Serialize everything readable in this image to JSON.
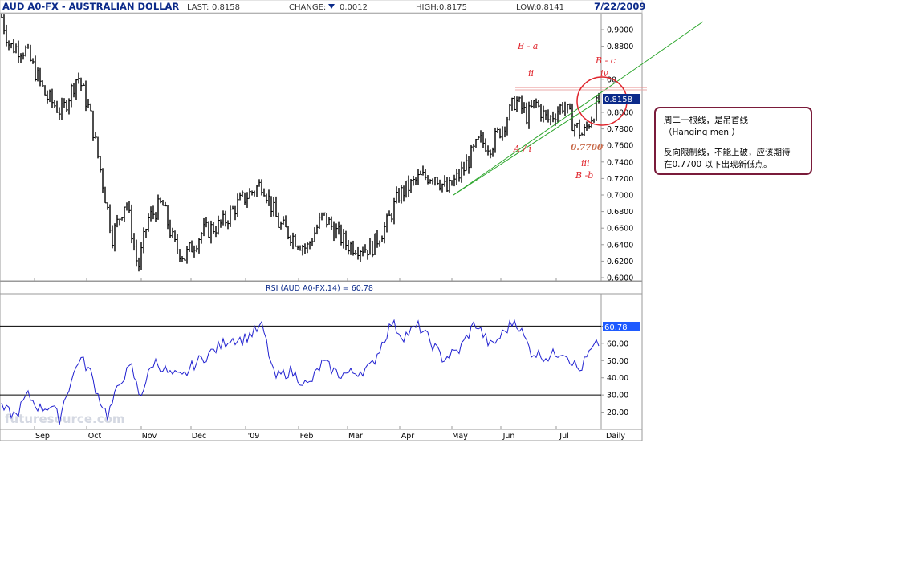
{
  "header": {
    "title": "AUD A0-FX - AUSTRALIAN DOLLAR",
    "last_label": "LAST:",
    "last_value": "0.8158",
    "change_label": "CHANGE:",
    "change_value": "0.0012",
    "high_label": "HIGH:",
    "high_value": "0.8175",
    "low_label": "LOW:",
    "low_value": "0.8141",
    "date": "7/22/2009"
  },
  "chart_data": [
    {
      "type": "bar",
      "title": "AUD A0-FX - AUSTRALIAN DOLLAR",
      "period": "Daily",
      "ylim": [
        0.6,
        0.92
      ],
      "y_ticks": [
        "0.9000",
        "0.8800",
        "00",
        "0.8000",
        "0.7800",
        "0.7600",
        "0.7400",
        "0.7200",
        "0.7000",
        "0.6800",
        "0.6600",
        "0.6400",
        "0.6200",
        "0.6000"
      ],
      "y_tick_values": [
        0.9,
        0.88,
        0.84,
        0.8,
        0.78,
        0.76,
        0.74,
        0.72,
        0.7,
        0.68,
        0.66,
        0.64,
        0.62,
        0.6
      ],
      "last_price_label": "0.8158",
      "last_price": 0.8158,
      "x_ticks": [
        "Sep",
        "Oct",
        "Nov",
        "Dec",
        "'09",
        "Feb",
        "Mar",
        "Apr",
        "May",
        "Jun",
        "Jul",
        "Daily"
      ],
      "close_keypoints": [
        {
          "t": 0,
          "v": 0.915
        },
        {
          "t": 10,
          "v": 0.88
        },
        {
          "t": 30,
          "v": 0.875
        },
        {
          "t": 55,
          "v": 0.82
        },
        {
          "t": 75,
          "v": 0.8
        },
        {
          "t": 95,
          "v": 0.845
        },
        {
          "t": 110,
          "v": 0.8
        },
        {
          "t": 125,
          "v": 0.72
        },
        {
          "t": 138,
          "v": 0.65
        },
        {
          "t": 155,
          "v": 0.695
        },
        {
          "t": 170,
          "v": 0.61
        },
        {
          "t": 182,
          "v": 0.67
        },
        {
          "t": 200,
          "v": 0.69
        },
        {
          "t": 215,
          "v": 0.64
        },
        {
          "t": 228,
          "v": 0.625
        },
        {
          "t": 250,
          "v": 0.655
        },
        {
          "t": 275,
          "v": 0.665
        },
        {
          "t": 295,
          "v": 0.69
        },
        {
          "t": 325,
          "v": 0.715
        },
        {
          "t": 345,
          "v": 0.665
        },
        {
          "t": 380,
          "v": 0.635
        },
        {
          "t": 400,
          "v": 0.675
        },
        {
          "t": 430,
          "v": 0.64
        },
        {
          "t": 460,
          "v": 0.635
        },
        {
          "t": 480,
          "v": 0.665
        },
        {
          "t": 495,
          "v": 0.7
        },
        {
          "t": 520,
          "v": 0.72
        },
        {
          "t": 540,
          "v": 0.725
        },
        {
          "t": 555,
          "v": 0.705
        },
        {
          "t": 575,
          "v": 0.73
        },
        {
          "t": 595,
          "v": 0.765
        },
        {
          "t": 610,
          "v": 0.76
        },
        {
          "t": 628,
          "v": 0.79
        },
        {
          "t": 640,
          "v": 0.815
        },
        {
          "t": 655,
          "v": 0.795
        },
        {
          "t": 665,
          "v": 0.812
        },
        {
          "t": 680,
          "v": 0.79
        },
        {
          "t": 700,
          "v": 0.81
        },
        {
          "t": 710,
          "v": 0.79
        },
        {
          "t": 724,
          "v": 0.772
        },
        {
          "t": 735,
          "v": 0.795
        },
        {
          "t": 745,
          "v": 0.8158
        }
      ],
      "annotations": [
        {
          "text": "B - a",
          "x": 650,
          "y": 0.882
        },
        {
          "text": "B - c",
          "x": 747,
          "y": 0.856
        },
        {
          "text": "ii",
          "x": 662,
          "y": 0.846
        },
        {
          "text": "iv",
          "x": 752,
          "y": 0.846
        },
        {
          "text": "A / i",
          "x": 652,
          "y": 0.755
        },
        {
          "text": "0.7700",
          "x": 728,
          "y": 0.755
        },
        {
          "text": "iii",
          "x": 730,
          "y": 0.735
        },
        {
          "text": "B -b",
          "x": 728,
          "y": 0.718
        }
      ]
    },
    {
      "type": "line",
      "title": "RSI (AUD A0-FX,14) = 60.78",
      "ylim": [
        10,
        80
      ],
      "y_ticks": [
        "70.00",
        "60.00",
        "50.00",
        "40.00",
        "30.00",
        "20.00"
      ],
      "y_tick_values": [
        70,
        60,
        50,
        40,
        30,
        20
      ],
      "reference_lines": [
        70,
        30
      ],
      "last_value_label": "60.78",
      "last_value": 60.78,
      "series": [
        {
          "values_keypoints": [
            {
              "t": 0,
              "v": 22
            },
            {
              "t": 18,
              "v": 18
            },
            {
              "t": 32,
              "v": 30
            },
            {
              "t": 48,
              "v": 22
            },
            {
              "t": 62,
              "v": 24
            },
            {
              "t": 72,
              "v": 16
            },
            {
              "t": 80,
              "v": 30
            },
            {
              "t": 90,
              "v": 42
            },
            {
              "t": 97,
              "v": 52
            },
            {
              "t": 110,
              "v": 44
            },
            {
              "t": 120,
              "v": 30
            },
            {
              "t": 132,
              "v": 18
            },
            {
              "t": 150,
              "v": 40
            },
            {
              "t": 162,
              "v": 46
            },
            {
              "t": 172,
              "v": 29
            },
            {
              "t": 190,
              "v": 50
            },
            {
              "t": 210,
              "v": 42
            },
            {
              "t": 225,
              "v": 40
            },
            {
              "t": 240,
              "v": 48
            },
            {
              "t": 265,
              "v": 56
            },
            {
              "t": 285,
              "v": 63
            },
            {
              "t": 300,
              "v": 62
            },
            {
              "t": 325,
              "v": 70
            },
            {
              "t": 340,
              "v": 40
            },
            {
              "t": 360,
              "v": 44
            },
            {
              "t": 382,
              "v": 35
            },
            {
              "t": 400,
              "v": 49
            },
            {
              "t": 420,
              "v": 42
            },
            {
              "t": 440,
              "v": 43
            },
            {
              "t": 460,
              "v": 46
            },
            {
              "t": 486,
              "v": 72
            },
            {
              "t": 500,
              "v": 64
            },
            {
              "t": 520,
              "v": 70
            },
            {
              "t": 550,
              "v": 51
            },
            {
              "t": 570,
              "v": 56
            },
            {
              "t": 590,
              "v": 72
            },
            {
              "t": 610,
              "v": 58
            },
            {
              "t": 640,
              "v": 74
            },
            {
              "t": 660,
              "v": 55
            },
            {
              "t": 680,
              "v": 52
            },
            {
              "t": 700,
              "v": 56
            },
            {
              "t": 720,
              "v": 44
            },
            {
              "t": 732,
              "v": 54
            },
            {
              "t": 745,
              "v": 60.78
            }
          ]
        }
      ]
    }
  ],
  "x_axis_labels": [
    "Sep",
    "Oct",
    "Nov",
    "Dec",
    "'09",
    "Feb",
    "Mar",
    "Apr",
    "May",
    "Jun",
    "Jul",
    "Daily"
  ],
  "rsi_title": "RSI (AUD A0-FX,14) = 60.78",
  "watermark": "futuresource.com",
  "note": {
    "line1": "周二一根线，是吊首线",
    "line2": "（Hanging men ）",
    "line3": "反向限制线，不能上破，应该期待",
    "line4": "在0.7700 以下出现新低点。"
  },
  "colors": {
    "bars": "#000000",
    "rsi_line": "#2020d0",
    "trend_line": "#2aa52a",
    "annotation": "#e0252c",
    "highlight_box": "#0b2a8a",
    "note_border": "#7a1b3a",
    "circle": "#e0252c",
    "header_title": "#0b2a8a"
  }
}
